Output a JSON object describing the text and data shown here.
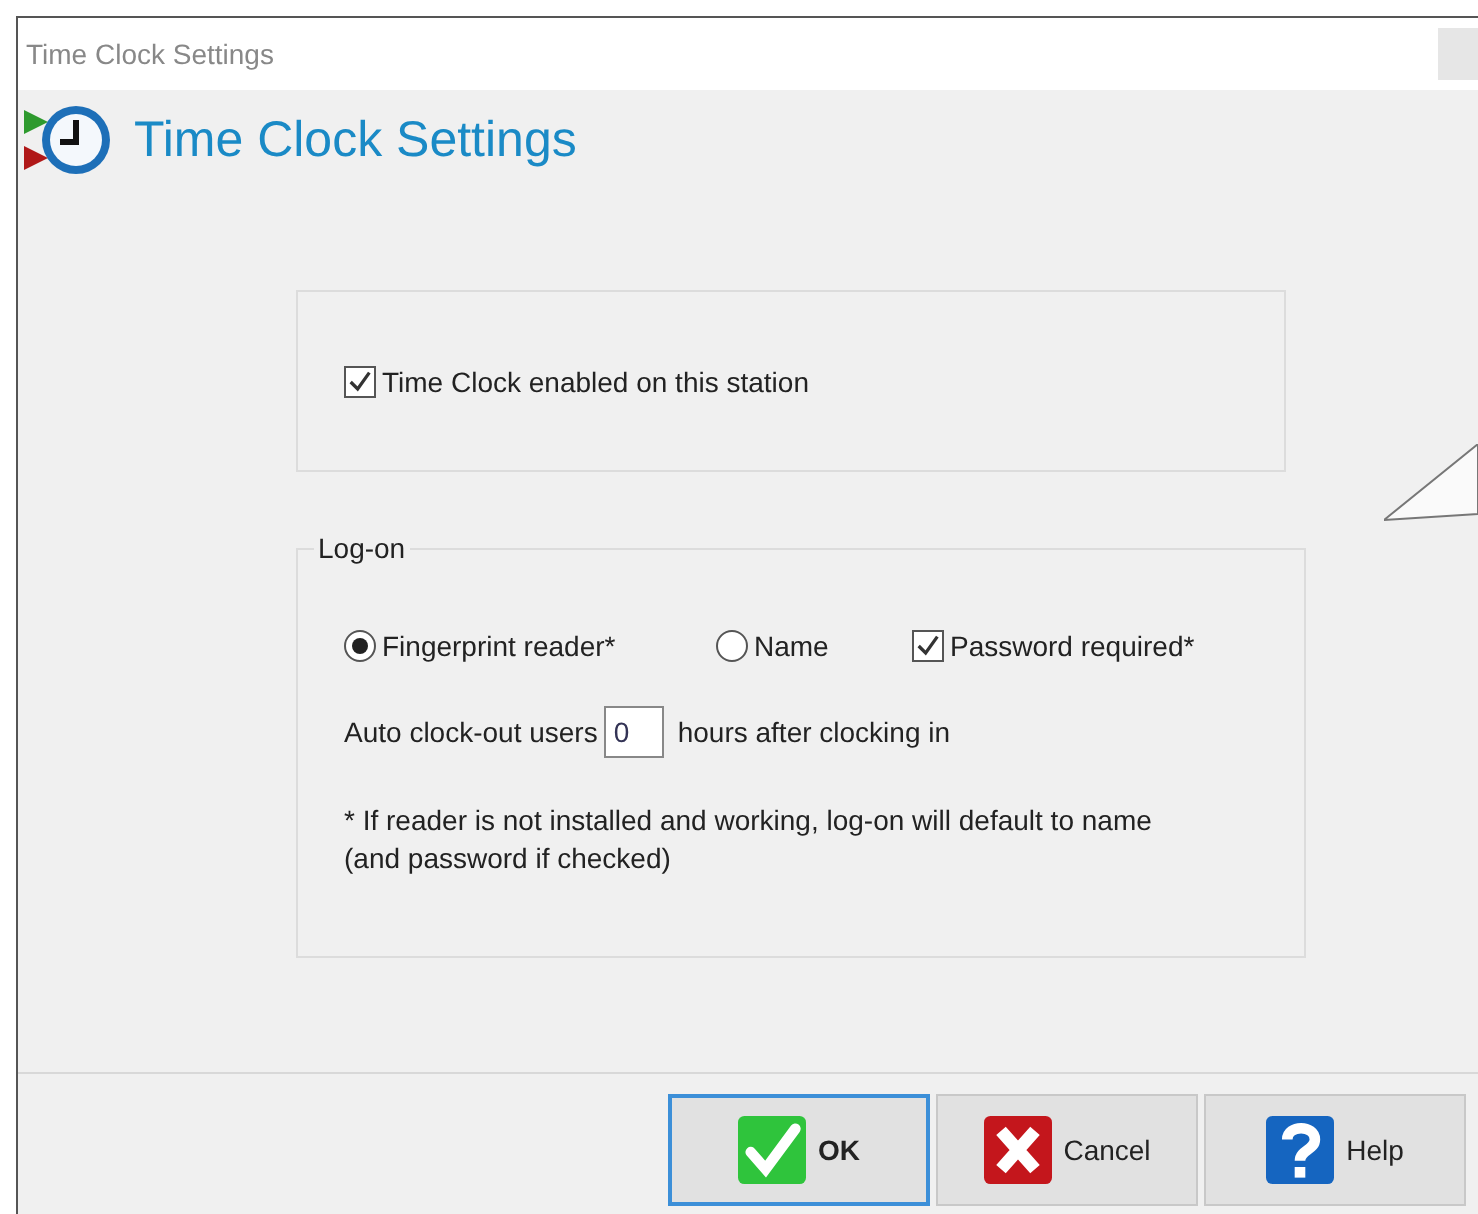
{
  "window": {
    "title": "Time Clock Settings"
  },
  "header": {
    "title": "Time Clock Settings"
  },
  "station": {
    "label": "Time Clock enabled on this station",
    "checked": true
  },
  "logon": {
    "legend": "Log-on",
    "options": [
      {
        "kind": "radio",
        "label": "Fingerprint reader*",
        "selected": true
      },
      {
        "kind": "radio",
        "label": "Name",
        "selected": false
      },
      {
        "kind": "checkbox",
        "label": "Password required*",
        "checked": true
      }
    ],
    "auto_clockout": {
      "prefix": "Auto clock-out users",
      "value": "0",
      "suffix": "hours after clocking in"
    },
    "note": "* If reader is not installed and working, log-on will default to name (and password if checked)"
  },
  "buttons": [
    {
      "kind": "ok",
      "label": "OK",
      "focused": true
    },
    {
      "kind": "cancel",
      "label": "Cancel",
      "focused": false
    },
    {
      "kind": "help",
      "label": "Help",
      "focused": false
    }
  ]
}
